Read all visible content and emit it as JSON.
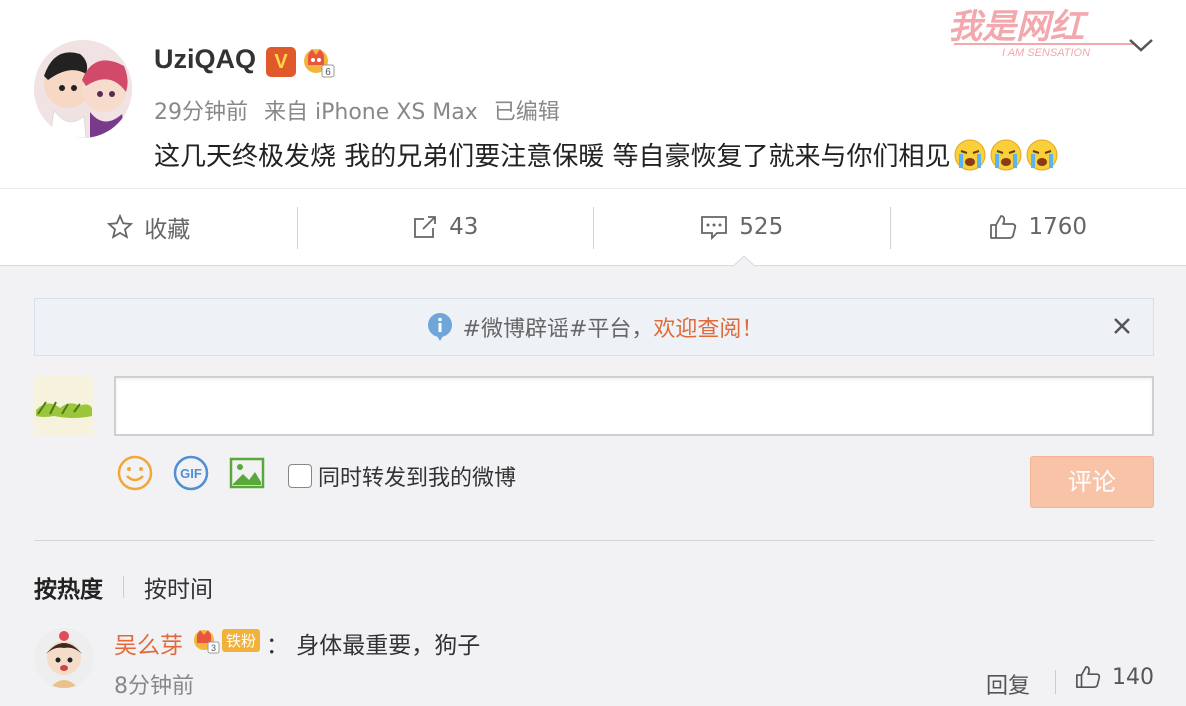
{
  "post": {
    "username": "UziQAQ",
    "verified_badge": "V",
    "time": "29分钟前",
    "source": "来自 iPhone XS Max",
    "edited": "已编辑",
    "text": "这几天终极发烧 我的兄弟们要注意保暖 等自豪恢复了就来与你们相见",
    "emojis": [
      "crying-emoji",
      "crying-emoji",
      "crying-emoji"
    ],
    "watermark": {
      "title": "我是网红",
      "subtitle": "I AM SENSATION"
    }
  },
  "actions": {
    "favorite": "收藏",
    "repost": "43",
    "comment": "525",
    "like": "1760"
  },
  "notice": {
    "prefix": "#微博辟谣#平台，",
    "link": "欢迎查阅！"
  },
  "composer": {
    "input_value": "",
    "repost_checkbox": "同时转发到我的微博",
    "submit": "评论"
  },
  "sort": {
    "hot": "按热度",
    "time": "按时间"
  },
  "comments": [
    {
      "name": "吴么芽",
      "fan_badge": "铁粉",
      "text": "：  身体最重要，狗子",
      "time": "8分钟前",
      "reply": "回复",
      "likes": "140"
    }
  ],
  "colors": {
    "accent": "#e06a3a",
    "submit_disabled": "#f9c3a8",
    "comment_bg": "#f2f2f5"
  }
}
